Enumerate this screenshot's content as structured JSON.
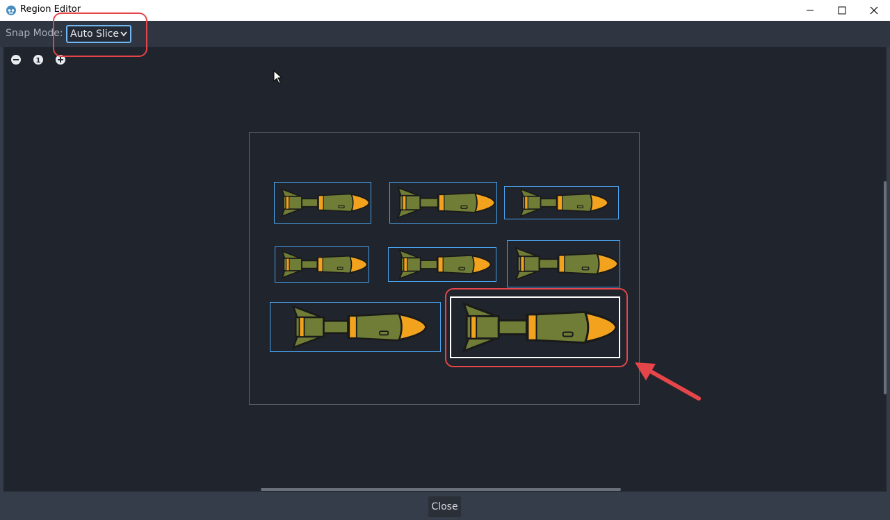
{
  "window": {
    "title": "Region Editor",
    "app_icon": "godot-icon",
    "controls": [
      "minimize-icon",
      "maximize-icon",
      "close-icon"
    ]
  },
  "toolbar": {
    "snap_label": "Snap Mode:",
    "snap_value": "Auto Slice"
  },
  "zoom_controls": [
    "zoom-out-icon",
    "zoom-reset-icon",
    "zoom-in-icon"
  ],
  "regions": [
    {
      "sprite": "bomb-small-fat",
      "selected": false
    },
    {
      "sprite": "missile-slim",
      "selected": false
    },
    {
      "sprite": "bomb-long",
      "selected": false
    },
    {
      "sprite": "bomb-small",
      "selected": false
    },
    {
      "sprite": "missile-finned",
      "selected": false
    },
    {
      "sprite": "bomb-winged",
      "selected": false
    },
    {
      "sprite": "bomb-large",
      "selected": false
    },
    {
      "sprite": "bomb-large-selected",
      "selected": true
    }
  ],
  "footer": {
    "close_label": "Close"
  },
  "colors": {
    "accent_blue": "#4aa3ef",
    "annotation_red": "#e6454a",
    "bomb_green": "#6f7d36",
    "bomb_orange": "#f2a21d"
  }
}
